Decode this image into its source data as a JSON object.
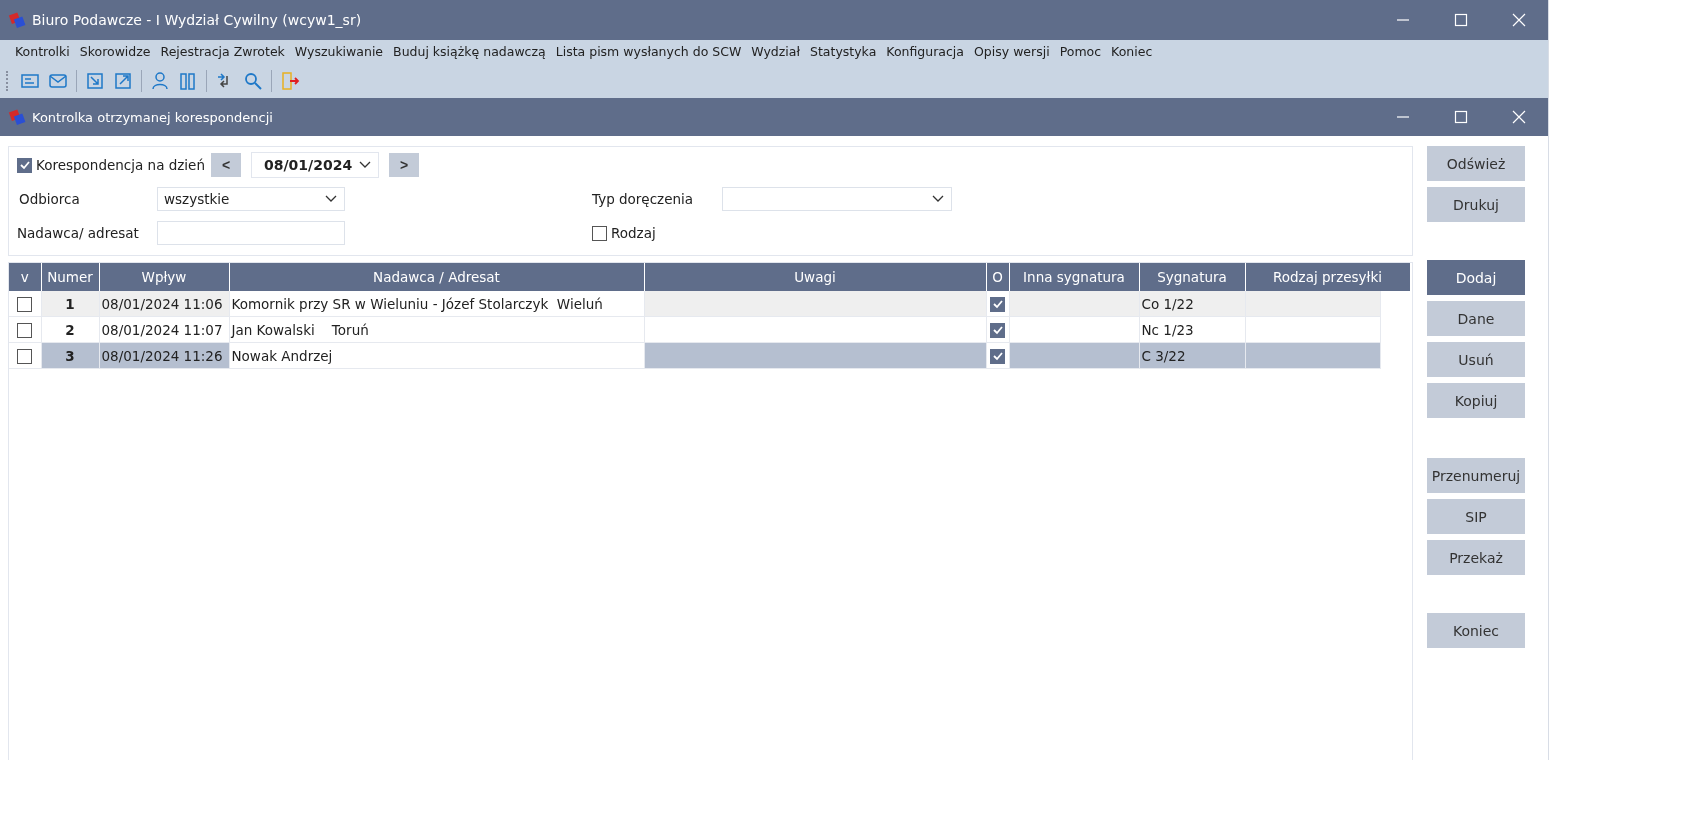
{
  "window": {
    "title": "Biuro Podawcze - I Wydział Cywilny (wcyw1_sr)"
  },
  "menu": [
    "Kontrolki",
    "Skorowidze",
    "Rejestracja Zwrotek",
    "Wyszukiwanie",
    "Buduj książkę nadawczą",
    "Lista pism wysłanych do SCW",
    "Wydział",
    "Statystyka",
    "Konfiguracja",
    "Opisy wersji",
    "Pomoc",
    "Koniec"
  ],
  "child_window": {
    "title": "Kontrolka otrzymanej korespondencji"
  },
  "filters": {
    "date_checkbox": {
      "label": "Korespondencja na dzień",
      "checked": true
    },
    "prev": "<",
    "date": "08/01/2024",
    "next": ">",
    "recipient": {
      "label": "Odbiorca",
      "value": "wszystkie"
    },
    "delivery_type": {
      "label": "Typ doręczenia"
    },
    "sender": {
      "label": "Nadawca/ adresat"
    },
    "kind_checkbox": {
      "label": "Rodzaj",
      "checked": false
    }
  },
  "table": {
    "columns": [
      "v",
      "Numer",
      "Wpływ",
      "Nadawca / Adresat",
      "Uwagi",
      "O",
      "Inna sygnatura",
      "Sygnatura",
      "Rodzaj przesyłki"
    ],
    "rows": [
      {
        "checked": false,
        "number": "1",
        "received": "08/01/2024 11:06",
        "sender": "Komornik przy SR w Wieluniu - Józef Stolarczyk  Wieluń",
        "o": true,
        "signature": "Co 1/22",
        "selected": false
      },
      {
        "checked": false,
        "number": "2",
        "received": "08/01/2024 11:07",
        "sender": "Jan Kowalski    Toruń",
        "o": true,
        "signature": "Nc 1/23",
        "selected": false
      },
      {
        "checked": false,
        "number": "3",
        "received": "08/01/2024 11:26",
        "sender": "Nowak Andrzej",
        "o": true,
        "signature": "C 3/22",
        "selected": true
      }
    ]
  },
  "button_groups": [
    [
      {
        "label": "Odśwież",
        "focused": false
      },
      {
        "label": "Drukuj",
        "focused": false
      }
    ],
    [
      {
        "label": "Dodaj",
        "focused": true
      },
      {
        "label": "Dane",
        "focused": false
      },
      {
        "label": "Usuń",
        "focused": false
      },
      {
        "label": "Kopiuj",
        "focused": false
      }
    ],
    [
      {
        "label": "Przenumeruj",
        "focused": false
      },
      {
        "label": "SIP",
        "focused": false
      },
      {
        "label": "Przekaż",
        "focused": false
      }
    ],
    [
      {
        "label": "Koniec",
        "focused": false
      }
    ]
  ]
}
